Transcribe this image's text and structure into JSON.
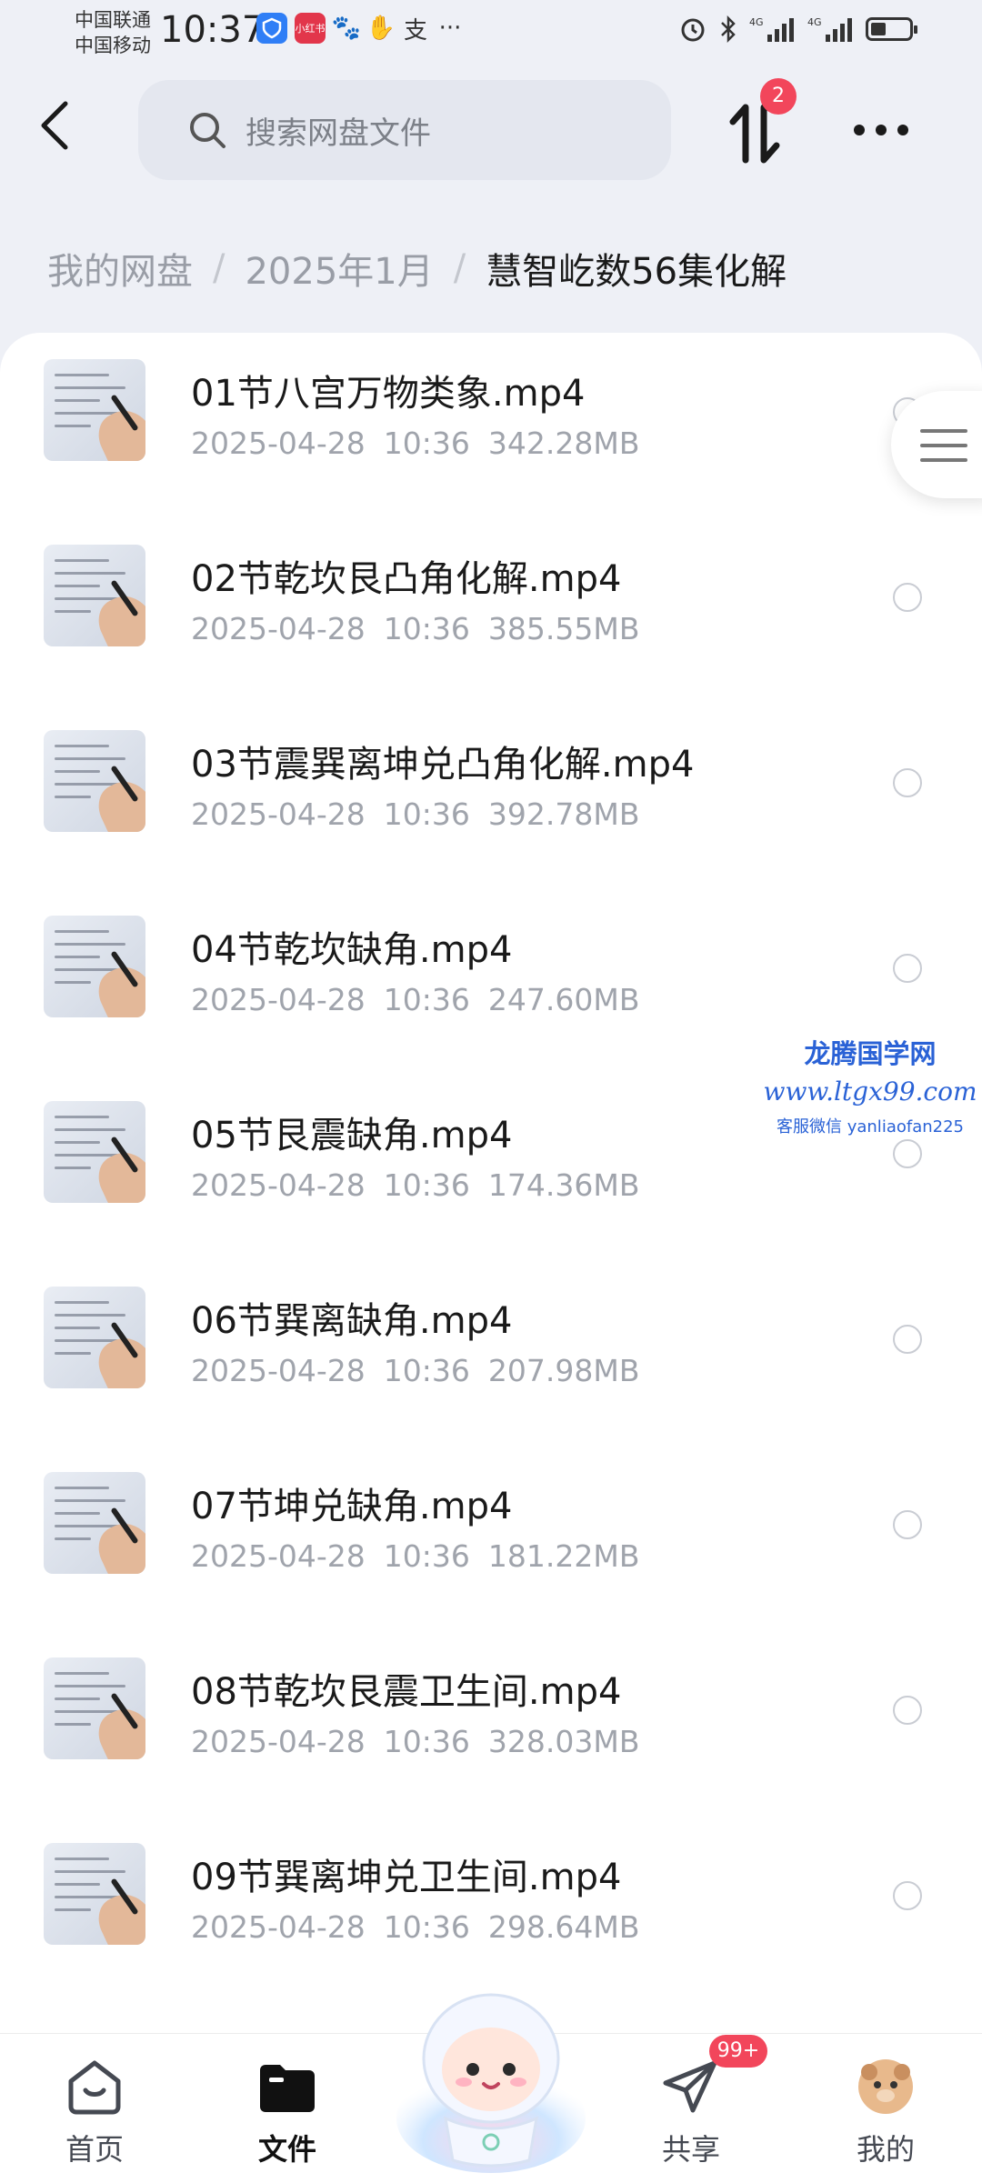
{
  "status_bar": {
    "carrier_1": "中国联通",
    "carrier_2": "中国移动",
    "time": "10:37",
    "app_icons": [
      "shield-app-icon",
      "xiaohongshu-icon",
      "paw-icon",
      "hand-icon",
      "alipay-icon"
    ],
    "more_dots": "···",
    "battery_level": 0.4
  },
  "header": {
    "search_placeholder": "搜索网盘文件",
    "transfer_count": "2"
  },
  "breadcrumb": {
    "items": [
      "我的网盘",
      "2025年1月",
      "慧智屹数56集化解"
    ],
    "separator": "/"
  },
  "files": [
    {
      "name": "01节八宫万物类象.mp4",
      "date": "2025-04-28",
      "time": "10:36",
      "size": "342.28MB"
    },
    {
      "name": "02节乾坎艮凸角化解.mp4",
      "date": "2025-04-28",
      "time": "10:36",
      "size": "385.55MB"
    },
    {
      "name": "03节震巽离坤兑凸角化解.mp4",
      "date": "2025-04-28",
      "time": "10:36",
      "size": "392.78MB"
    },
    {
      "name": "04节乾坎缺角.mp4",
      "date": "2025-04-28",
      "time": "10:36",
      "size": "247.60MB"
    },
    {
      "name": "05节艮震缺角.mp4",
      "date": "2025-04-28",
      "time": "10:36",
      "size": "174.36MB"
    },
    {
      "name": "06节巽离缺角.mp4",
      "date": "2025-04-28",
      "time": "10:36",
      "size": "207.98MB"
    },
    {
      "name": "07节坤兑缺角.mp4",
      "date": "2025-04-28",
      "time": "10:36",
      "size": "181.22MB"
    },
    {
      "name": "08节乾坎艮震卫生间.mp4",
      "date": "2025-04-28",
      "time": "10:36",
      "size": "328.03MB"
    },
    {
      "name": "09节巽离坤兑卫生间.mp4",
      "date": "2025-04-28",
      "time": "10:36",
      "size": "298.64MB"
    }
  ],
  "watermark": {
    "title": "龙腾国学网",
    "url": "www.ltgx99.com",
    "contact": "客服微信 yanliaofan225"
  },
  "bottom_nav": {
    "items": [
      {
        "label": "首页",
        "icon": "home-icon"
      },
      {
        "label": "文件",
        "icon": "folder-icon",
        "active": true
      },
      {
        "label": "共享",
        "icon": "paper-plane-icon"
      },
      {
        "label": "我的",
        "icon": "avatar-icon"
      }
    ],
    "share_badge": "99+",
    "colors": {
      "badge": "#f2465b",
      "active": "#111111"
    }
  }
}
